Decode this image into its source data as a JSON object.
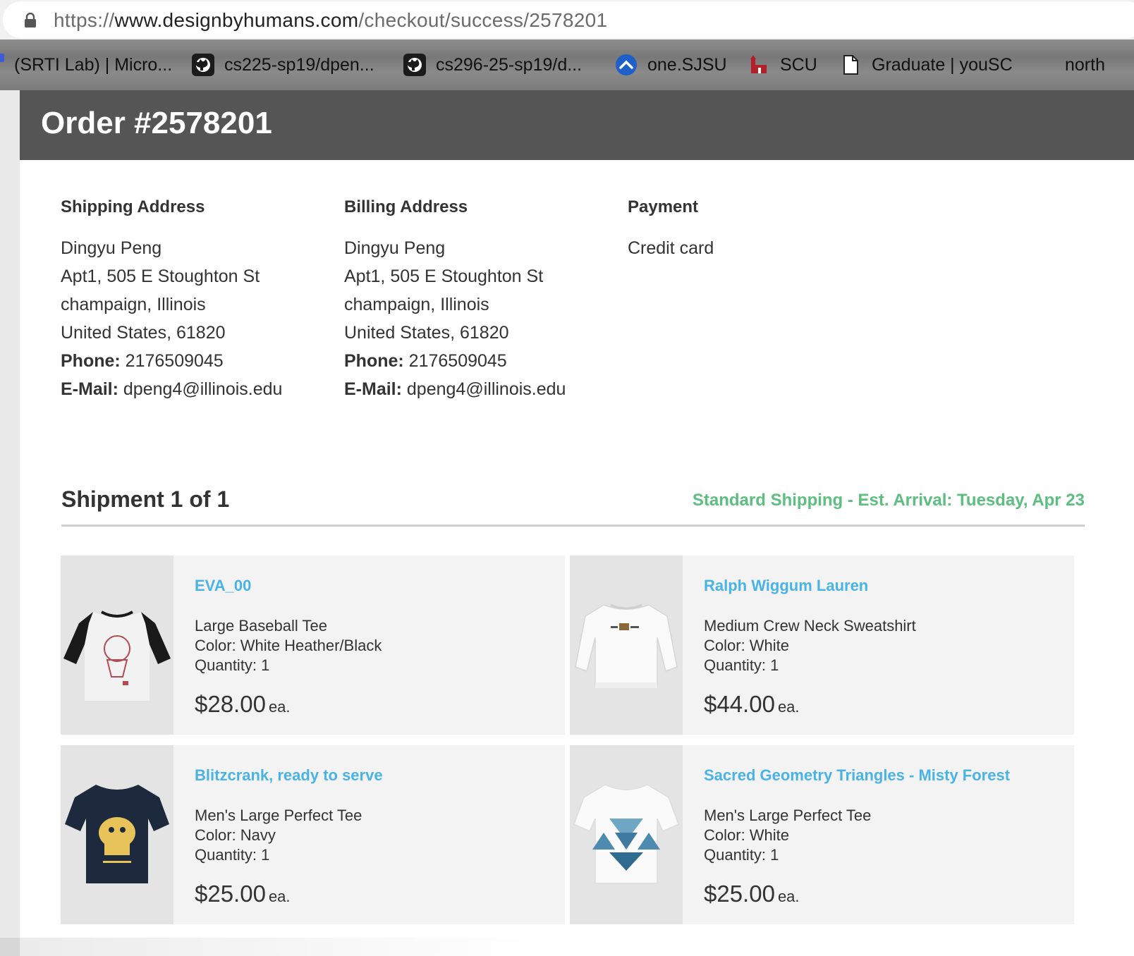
{
  "browser": {
    "url_scheme": "https://",
    "url_host": "www.designbyhumans.com",
    "url_path": "/checkout/success/2578201",
    "bookmarks": [
      {
        "label": "(SRTI Lab) | Micro...",
        "icon": "microsoft-icon"
      },
      {
        "label": "cs225-sp19/dpen...",
        "icon": "github-icon"
      },
      {
        "label": "cs296-25-sp19/d...",
        "icon": "github-icon"
      },
      {
        "label": "one.SJSU",
        "icon": "sjsu-icon"
      },
      {
        "label": "SCU",
        "icon": "scu-icon"
      },
      {
        "label": "Graduate | youSC",
        "icon": "page-icon"
      },
      {
        "label": "north",
        "icon": "none"
      }
    ]
  },
  "order": {
    "title": "Order #2578201"
  },
  "shipping": {
    "heading": "Shipping Address",
    "name": "Dingyu Peng",
    "street": "Apt1, 505 E Stoughton St",
    "city": "champaign, Illinois",
    "country": "United States, 61820",
    "phone_label": "Phone:",
    "phone": "2176509045",
    "email_label": "E-Mail:",
    "email": "dpeng4@illinois.edu"
  },
  "billing": {
    "heading": "Billing Address",
    "name": "Dingyu Peng",
    "street": "Apt1, 505 E Stoughton St",
    "city": "champaign, Illinois",
    "country": "United States, 61820",
    "phone_label": "Phone:",
    "phone": "2176509045",
    "email_label": "E-Mail:",
    "email": "dpeng4@illinois.edu"
  },
  "payment": {
    "heading": "Payment",
    "method": "Credit card"
  },
  "shipment": {
    "title": "Shipment 1 of 1",
    "shipping_info": "Standard Shipping - Est. Arrival: Tuesday, Apr 23",
    "accent_color": "#5cbe7f",
    "link_color": "#4ab3e6"
  },
  "items": [
    {
      "name": "EVA_00",
      "product": "Large Baseball Tee",
      "color": "Color: White Heather/Black",
      "quantity": "Quantity: 1",
      "price": "$28.00",
      "unit": "ea.",
      "thumb": "baseball-tee-icon"
    },
    {
      "name": "Ralph Wiggum Lauren",
      "product": "Medium Crew Neck Sweatshirt",
      "color": "Color: White",
      "quantity": "Quantity: 1",
      "price": "$44.00",
      "unit": "ea.",
      "thumb": "sweatshirt-icon"
    },
    {
      "name": "Blitzcrank, ready to serve",
      "product": "Men's Large Perfect Tee",
      "color": "Color: Navy",
      "quantity": "Quantity: 1",
      "price": "$25.00",
      "unit": "ea.",
      "thumb": "navy-tee-icon"
    },
    {
      "name": "Sacred Geometry Triangles - Misty Forest",
      "product": "Men's Large Perfect Tee",
      "color": "Color: White",
      "quantity": "Quantity: 1",
      "price": "$25.00",
      "unit": "ea.",
      "thumb": "white-tee-icon"
    }
  ]
}
